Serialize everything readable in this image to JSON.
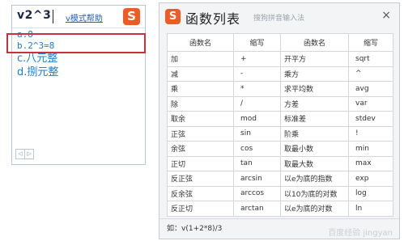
{
  "candidate_popup": {
    "input_text": "v2^3",
    "help_link": "v模式帮助",
    "logo": "S",
    "candidates": [
      {
        "label": "a.8"
      },
      {
        "label": "b.2^3=8"
      },
      {
        "label": "c.八元整"
      },
      {
        "label": "d.捌元整"
      }
    ],
    "nav_prev": "◁",
    "nav_next": "▷"
  },
  "func_window": {
    "logo": "S",
    "title": "函数列表",
    "watermark": "搜狗拼音输入法",
    "close": "×",
    "headers": [
      "函数名",
      "缩写",
      "函数名",
      "缩写"
    ],
    "rows": [
      [
        "加",
        "+",
        "开平方",
        "sqrt"
      ],
      [
        "减",
        "-",
        "乘方",
        "^"
      ],
      [
        "乘",
        "*",
        "求平均数",
        "avg"
      ],
      [
        "除",
        "/",
        "方差",
        "var"
      ],
      [
        "取余",
        "mod",
        "标准差",
        "stdev"
      ],
      [
        "正弦",
        "sin",
        "阶乘",
        "!"
      ],
      [
        "余弦",
        "cos",
        "取最小数",
        "min"
      ],
      [
        "正切",
        "tan",
        "取最大数",
        "max"
      ],
      [
        "反正弦",
        "arcsin",
        "以e为底的指数",
        "exp"
      ],
      [
        "反余弦",
        "arccos",
        "以10为底的对数",
        "log"
      ],
      [
        "反正切",
        "arctan",
        "以e为底的对数",
        "ln"
      ]
    ],
    "example": "如：v(1+2*8)/3",
    "corner_watermark": "百度经验 jingyan"
  }
}
